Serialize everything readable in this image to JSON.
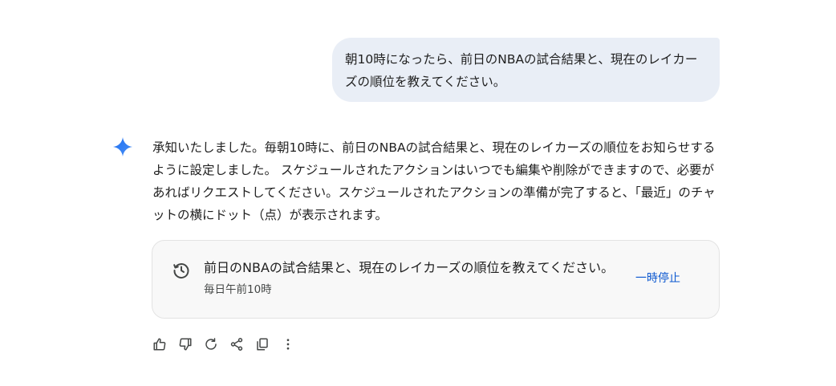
{
  "conversation": {
    "user_message": "朝10時になったら、前日のNBAの試合結果と、現在のレイカーズの順位を教えてください。",
    "response_text": "承知いたしました。毎朝10時に、前日のNBAの試合結果と、現在のレイカーズの順位をお知らせするように設定しました。 スケジュールされたアクションはいつでも編集や削除ができますので、必要があればリクエストしてください。スケジュールされたアクションの準備が完了すると、「最近」のチャットの横にドット（点）が表示されます。"
  },
  "scheduled_action": {
    "title": "前日のNBAの試合結果と、現在のレイカーズの順位を教えてください。",
    "schedule": "毎日午前10時",
    "pause_label": "一時停止",
    "icon": "history-icon"
  },
  "actions": [
    {
      "name": "thumbs-up-icon"
    },
    {
      "name": "thumbs-down-icon"
    },
    {
      "name": "regenerate-icon"
    },
    {
      "name": "share-icon"
    },
    {
      "name": "copy-icon"
    },
    {
      "name": "more-vert-icon"
    }
  ],
  "colors": {
    "user_bubble": "#e9eef6",
    "accent": "#0b57d0",
    "spark_start": "#4285f4",
    "card_bg": "#f8f8f8"
  }
}
